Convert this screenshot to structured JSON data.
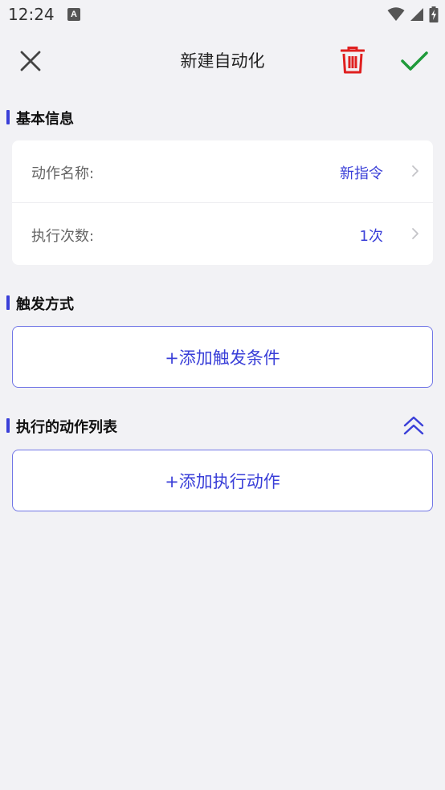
{
  "status_bar": {
    "time": "12:24",
    "notification_letter": "A"
  },
  "app_bar": {
    "title": "新建自动化",
    "close_icon": "close-icon",
    "delete_icon": "trash-icon",
    "confirm_icon": "checkmark-icon"
  },
  "basic_info": {
    "title": "基本信息",
    "rows": [
      {
        "label": "动作名称:",
        "value": "新指令"
      },
      {
        "label": "执行次数:",
        "value": "1次"
      }
    ]
  },
  "trigger": {
    "title": "触发方式",
    "add_label": "+添加触发条件"
  },
  "actions": {
    "title": "执行的动作列表",
    "add_label": "+添加执行动作",
    "collapse_icon": "double-chevron-up-icon"
  },
  "colors": {
    "accent": "#3a3fd8",
    "delete": "#e02020",
    "confirm": "#1f9a3a",
    "background": "#f2f2f5"
  }
}
